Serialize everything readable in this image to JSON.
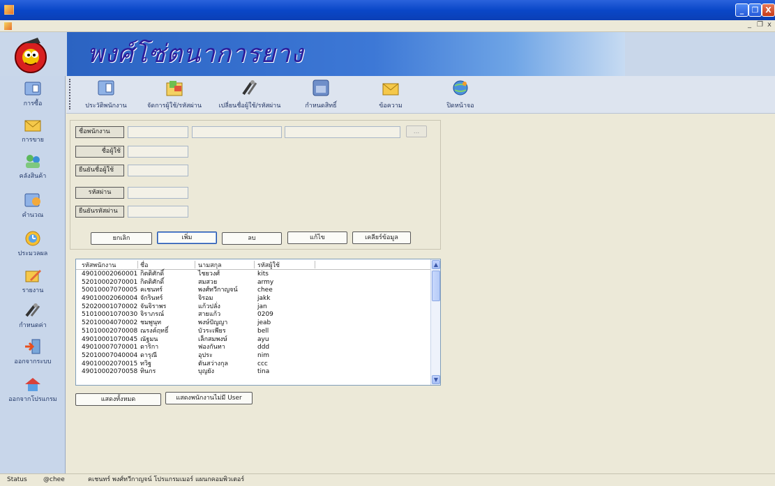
{
  "app": {
    "banner_title": "พงศ์โซ่ตนาการยาง",
    "window_buttons": {
      "minimize": "_",
      "maximize": "❐",
      "close": "X"
    },
    "mdi_buttons": {
      "minimize": "_",
      "restore": "❐",
      "close": "x"
    }
  },
  "sidebar": {
    "items": [
      {
        "label": "การซื้อ",
        "icon": "purchase-icon"
      },
      {
        "label": "การขาย",
        "icon": "sell-envelope-icon"
      },
      {
        "label": "คลังสินค้า",
        "icon": "warehouse-people-icon"
      },
      {
        "label": "คำนวณ",
        "icon": "calculate-icon"
      },
      {
        "label": "ประมวลผล",
        "icon": "process-clock-icon"
      },
      {
        "label": "รายงาน",
        "icon": "report-pencil-icon"
      },
      {
        "label": "กำหนดค่า",
        "icon": "settings-tools-icon"
      },
      {
        "label": "ออกจากระบบ",
        "icon": "logout-door-icon"
      },
      {
        "label": "ออกจากโปรแกรม",
        "icon": "exit-house-icon"
      }
    ]
  },
  "toolbar": {
    "items": [
      {
        "label": "ประวัติพนักงาน",
        "icon": "employee-history-icon"
      },
      {
        "label": "จัดการผู้ใช้/รหัสผ่าน",
        "icon": "manage-users-icon"
      },
      {
        "label": "เปลี่ยนชื่อผู้ใช้/รหัสผ่าน",
        "icon": "change-password-tools-icon"
      },
      {
        "label": "กำหนดสิทธิ์",
        "icon": "permissions-icon"
      },
      {
        "label": "ข้อความ",
        "icon": "message-envelope-icon"
      },
      {
        "label": "ปิดหน้าจอ",
        "icon": "close-screen-globe-icon"
      }
    ]
  },
  "form": {
    "employee_name_label": "ชื่อพนักงาน",
    "username_label": "ชื่อผู้ใช้",
    "confirm_username_label": "ยืนยันชื่อผู้ใช้",
    "password_label": "รหัสผ่าน",
    "confirm_password_label": "ยืนยันรหัสผ่าน",
    "browse_button": "...",
    "buttons": {
      "cancel": "ยกเลิก",
      "add": "เพิ่ม",
      "delete": "ลบ",
      "edit": "แก้ไข",
      "clear": "เคลียร์ข้อมูล"
    }
  },
  "grid": {
    "headers": [
      "รหัสพนักงาน",
      "ชื่อ",
      "นามสกุล",
      "รหัสผู้ใช้"
    ],
    "rows": [
      [
        "49010002060001",
        "กิตติศักดิ์",
        "ไชยวงศ์",
        "kits"
      ],
      [
        "52010002070001",
        "กิตติศักดิ์",
        "สมสวย",
        "army"
      ],
      [
        "50010007070005",
        "คเชนทร์",
        "พงศ์ทวีกาญจน์",
        "chee"
      ],
      [
        "49010002060004",
        "จักรินทร์",
        "จิรอม",
        "jakk"
      ],
      [
        "52020001070002",
        "จันจิราพร",
        "แก้วปลั่ง",
        "jan"
      ],
      [
        "51010001070030",
        "จิราภรณ์",
        "สายแก้ว",
        "0209"
      ],
      [
        "52010004070002",
        "ชมพูนุท",
        "พงษ์ปัญญา",
        "jeab"
      ],
      [
        "51010002070008",
        "ณรงค์ฤทธิ์",
        "บัวระเพียร",
        "bell"
      ],
      [
        "49010001070045",
        "ณัฐมน",
        "เล็กสมพงษ์",
        "ayu"
      ],
      [
        "49010007070001",
        "ดาริกา",
        "ฟองกันทา",
        "ddd"
      ],
      [
        "52010007040004",
        "ดารุณี",
        "อุประ",
        "nim"
      ],
      [
        "49010002070015",
        "ทวิฐ",
        "ตันสว่างกุล",
        "ccc"
      ],
      [
        "49010002070058",
        "ทินกร",
        "บุญยัง",
        "tina"
      ]
    ]
  },
  "bottom_buttons": {
    "show_all": "แสดงทั้งหมด",
    "show_no_user": "แสดงพนักงานไม่มี User"
  },
  "statusbar": {
    "label": "Status",
    "user": "@chee",
    "message": "คเชนทร์ พงศ์ทวีกาญจน์  โปรแกรมเมอร์  แผนกคอมพิวเตอร์"
  }
}
